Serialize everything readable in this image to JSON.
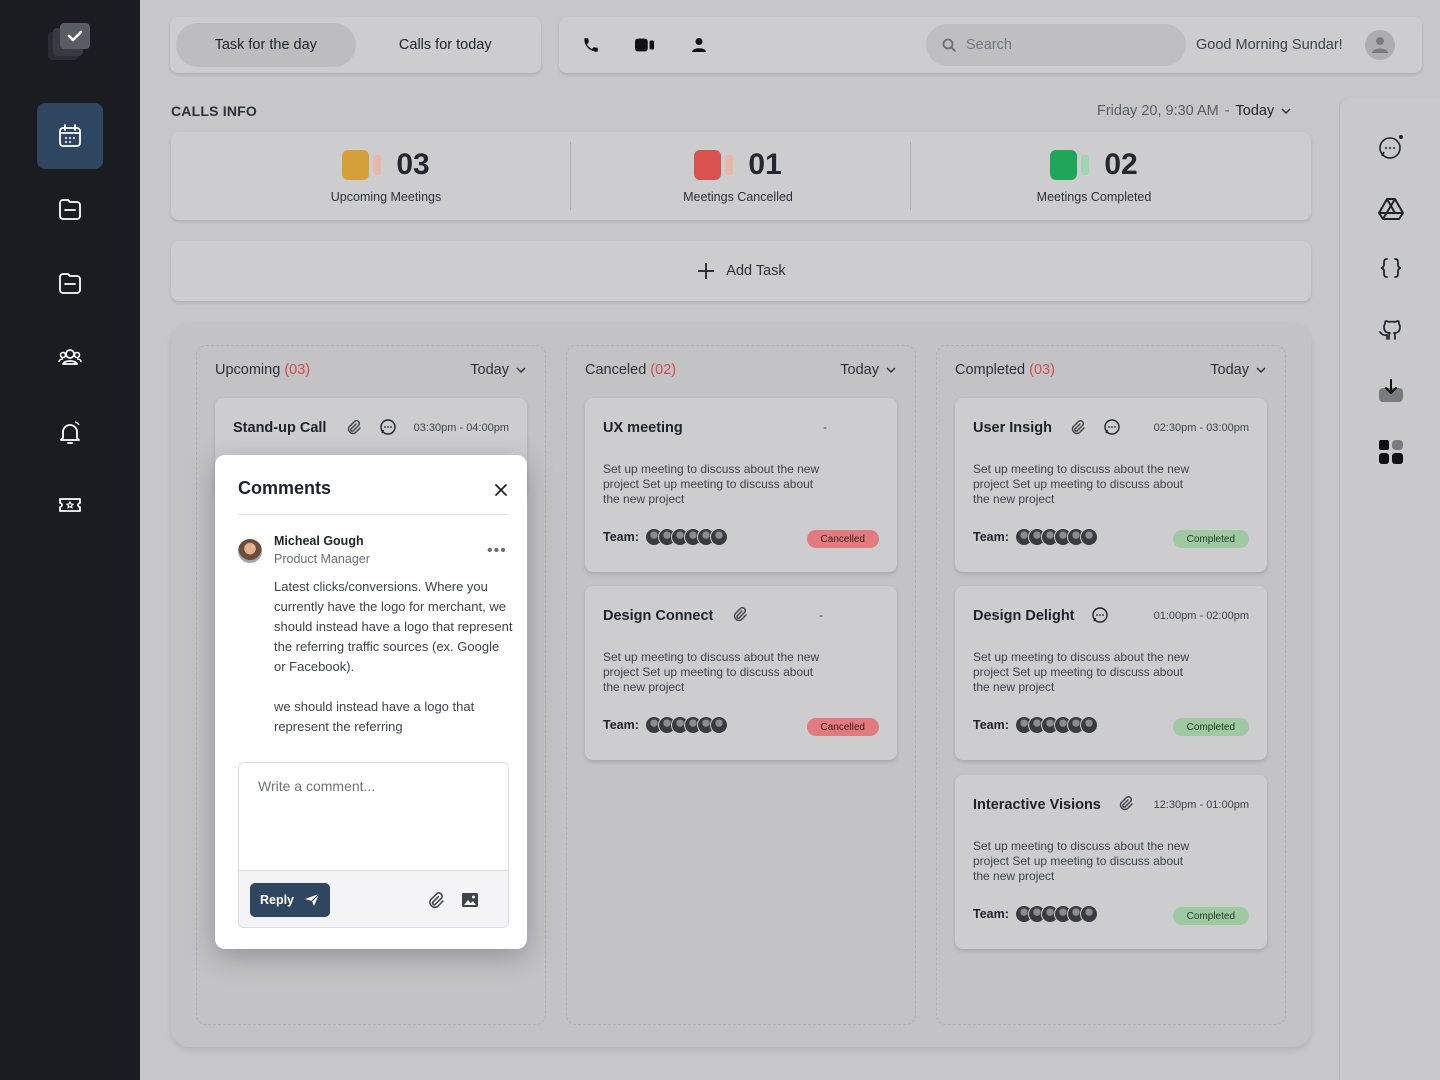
{
  "header": {
    "tabs": [
      {
        "label": "Task for the day",
        "active": true
      },
      {
        "label": "Calls for today",
        "active": false
      }
    ],
    "icons": [
      "phone-icon",
      "video-icon",
      "user-icon"
    ],
    "search": {
      "placeholder": "Search"
    },
    "greeting": "Good Morning Sundar!"
  },
  "sidebar": {
    "items": [
      "calendar-icon",
      "folder-icon",
      "folder-icon",
      "team-icon",
      "bell-icon",
      "ticket-icon"
    ],
    "active_index": 0
  },
  "calls_info": {
    "title": "CALLS INFO",
    "date": "Friday 20, 9:30 AM",
    "separator": "-",
    "filter": "Today",
    "stats": [
      {
        "value": "03",
        "label": "Upcoming Meetings",
        "color": "#d4a03a"
      },
      {
        "value": "01",
        "label": "Meetings Cancelled",
        "color": "#d8524f"
      },
      {
        "value": "02",
        "label": "Meetings Completed",
        "color": "#1fa65a"
      }
    ]
  },
  "add_task": {
    "label": "Add Task"
  },
  "columns": [
    {
      "title": "Upcoming",
      "count": "(03)",
      "filter": "Today"
    },
    {
      "title": "Canceled",
      "count": "(02)",
      "filter": "Today"
    },
    {
      "title": "Completed",
      "count": "(03)",
      "filter": "Today"
    }
  ],
  "upcoming_card": {
    "title": "Stand-up Call",
    "time": "03:30pm - 04:00pm"
  },
  "canceled_cards": [
    {
      "title": "UX meeting",
      "dash": "-",
      "desc": "Set up meeting to discuss about the new project Set up meeting to discuss about the new project",
      "team_label": "Team:",
      "status": "Cancelled"
    },
    {
      "title": "Design Connect",
      "dash": "-",
      "desc": "Set up meeting to discuss about the new project Set up meeting to discuss about the new project",
      "team_label": "Team:",
      "status": "Cancelled"
    }
  ],
  "completed_cards": [
    {
      "title": "User Insigh",
      "time": "02:30pm - 03:00pm",
      "desc": "Set up meeting to discuss about the new project Set up meeting to discuss about the new project",
      "team_label": "Team:",
      "status": "Completed"
    },
    {
      "title": "Design Delight",
      "time": "01:00pm - 02:00pm",
      "desc": "Set up meeting to discuss about the new project Set up meeting to discuss about the new project",
      "team_label": "Team:",
      "status": "Completed"
    },
    {
      "title": "Interactive Visions",
      "time": "12:30pm - 01:00pm",
      "desc": "Set up meeting to discuss about the new project Set up meeting to discuss about the new project",
      "team_label": "Team:",
      "status": "Completed"
    }
  ],
  "comments": {
    "title": "Comments",
    "author": "Micheal Gough",
    "role": "Product Manager",
    "more": "•••",
    "text_1": "Latest clicks/conversions. Where you currently have the logo for merchant, we should instead have a logo that represent the referring traffic sources (ex. Google or Facebook).",
    "text_2": "we should instead have a logo that represent the referring",
    "placeholder": "Write a comment...",
    "reply_label": "Reply"
  },
  "right_rail": {
    "icons": [
      "chat-icon",
      "drive-icon",
      "code-braces-icon",
      "github-icon",
      "download-icon",
      "apps-icon"
    ]
  }
}
